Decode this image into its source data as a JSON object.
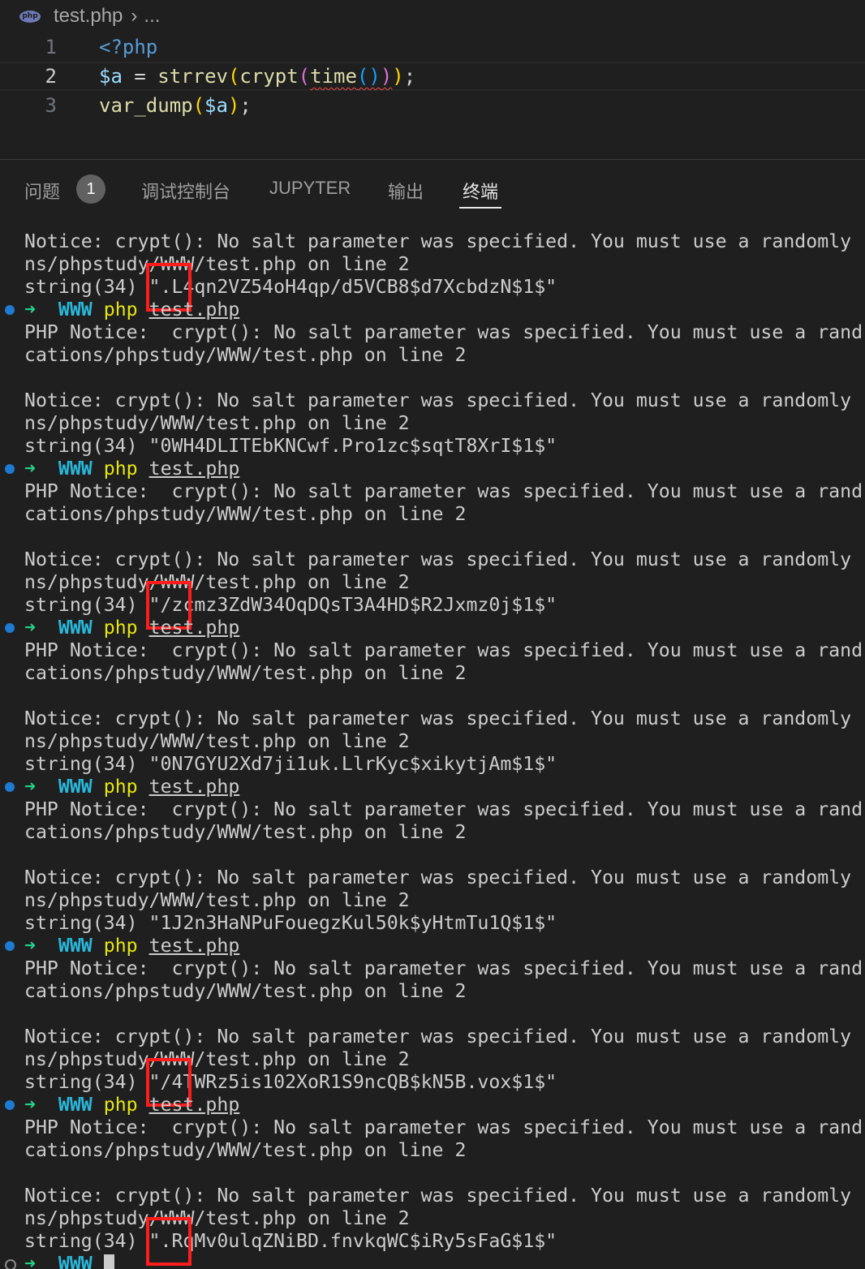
{
  "breadcrumb": {
    "file_icon": "php-file-icon",
    "file": "test.php",
    "separator": "›",
    "more": "..."
  },
  "editor": {
    "lines": [
      {
        "number": "1",
        "text": "<?php"
      },
      {
        "number": "2",
        "text": "$a = strrev(crypt(time()));"
      },
      {
        "number": "3",
        "text": "var_dump($a);"
      }
    ]
  },
  "panel": {
    "tabs": [
      {
        "label": "问题",
        "badge": "1"
      },
      {
        "label": "调试控制台"
      },
      {
        "label": "JUPYTER"
      },
      {
        "label": "输出"
      },
      {
        "label": "终端",
        "active": true
      }
    ]
  },
  "terminal": {
    "prompt": {
      "arrow": "➜",
      "dir": "WWW",
      "cmd": "php",
      "arg": "test.php"
    },
    "notice_line": "Notice: crypt(): No salt parameter was specified. You must use a randomly",
    "notice_path": "ns/phpstudy/WWW/test.php on line 2",
    "php_notice_line": "PHP Notice:  crypt(): No salt parameter was specified. You must use a rand",
    "php_notice_path": "cations/phpstudy/WWW/test.php on line 2",
    "outputs": [
      "string(34) \".L4qn2VZ54oH4qp/d5VCB8$d7XcbdzN$1$\"",
      "string(34) \"0WH4DLITEbKNCwf.Pro1zc$sqtT8XrI$1$\"",
      "string(34) \"/zcmz3ZdW34OqDQsT3A4HD$R2Jxmz0j$1$\"",
      "string(34) \"0N7GYU2Xd7ji1uk.LlrKyc$xikytjAm$1$\"",
      "string(34) \"1J2n3HaNPuFouegzKul50k$yHtmTu1Q$1$\"",
      "string(34) \"/4TWRz5is102XoR1S9ncQB$kN5B.vox$1$\"",
      "string(34) \".RqMv0ulqZNiBD.fnvkqWC$iRy5sFaG$1$\""
    ],
    "colors": {
      "highlight": "#ff1c1c",
      "prompt_arrow": "#23d18b",
      "prompt_dir": "#29b8db",
      "prompt_cmd": "#e5e510"
    }
  }
}
